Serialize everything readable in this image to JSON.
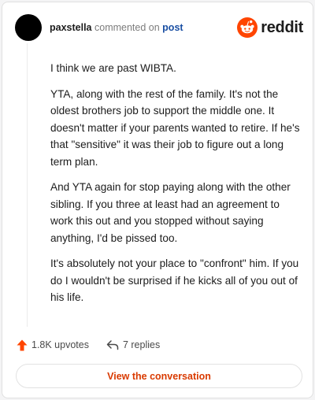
{
  "header": {
    "username": "paxstella",
    "commented_text": "commented on",
    "post_link": "post",
    "brand_name": "reddit",
    "brand_icon": "reddit-snoo-icon",
    "brand_color": "#ff4500"
  },
  "comment": {
    "paragraphs": [
      "I think we are past WIBTA.",
      "YTA, along with the rest of the family. It's not the oldest brothers job to support the middle one. It doesn't matter if your parents wanted to retire. If he's that \"sensitive\" it was their job to figure out a long term plan.",
      "And YTA again for stop paying along with the other sibling. If you three at least had an agreement to work this out and you stopped without saying anything, I'd be pissed too.",
      "It's absolutely not your place to \"confront\" him. If you do I wouldn't be surprised if he kicks all of you out of his life."
    ]
  },
  "actions": {
    "upvotes_label": "1.8K upvotes",
    "upvote_icon": "upvote-arrow-icon",
    "replies_label": "7 replies",
    "reply_icon": "reply-arrow-icon"
  },
  "cta": {
    "label": "View the conversation",
    "color": "#d93a00"
  }
}
